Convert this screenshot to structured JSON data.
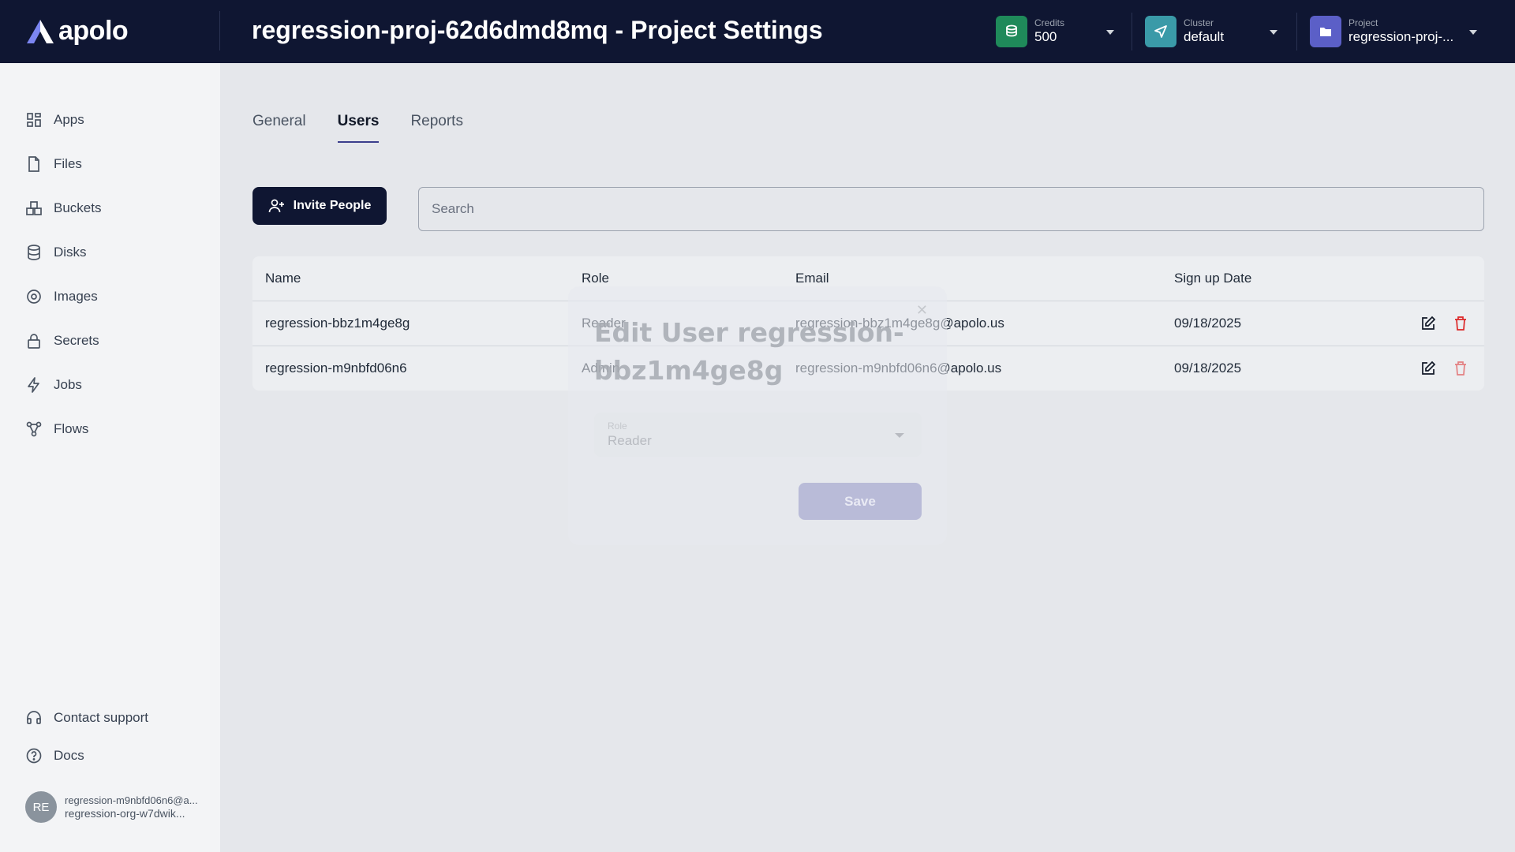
{
  "app": {
    "logo_text": "apolo"
  },
  "header": {
    "title": "regression-proj-62d6dmd8mq - Project Settings",
    "credits": {
      "label": "Credits",
      "value": "500",
      "icon": "coins-icon",
      "color": "#1f8a5a"
    },
    "cluster": {
      "label": "Cluster",
      "value": "default",
      "icon": "send-icon",
      "color": "#3a9aa8"
    },
    "project": {
      "label": "Project",
      "value": "regression-proj-...",
      "icon": "folder-icon",
      "color": "#5b5fc7"
    }
  },
  "sidebar": {
    "items": [
      {
        "label": "Apps",
        "icon": "grid-icon"
      },
      {
        "label": "Files",
        "icon": "file-icon"
      },
      {
        "label": "Buckets",
        "icon": "bucket-icon"
      },
      {
        "label": "Disks",
        "icon": "database-icon"
      },
      {
        "label": "Images",
        "icon": "disc-icon"
      },
      {
        "label": "Secrets",
        "icon": "lock-icon"
      },
      {
        "label": "Jobs",
        "icon": "bolt-icon"
      },
      {
        "label": "Flows",
        "icon": "flow-icon"
      }
    ],
    "support": {
      "label": "Contact support",
      "icon": "headset-icon"
    },
    "docs": {
      "label": "Docs",
      "icon": "help-circle-icon"
    },
    "user": {
      "initials": "RE",
      "email": "regression-m9nbfd06n6@a...",
      "org": "regression-org-w7dwik..."
    }
  },
  "tabs": [
    {
      "label": "General",
      "active": false
    },
    {
      "label": "Users",
      "active": true
    },
    {
      "label": "Reports",
      "active": false
    }
  ],
  "toolbar": {
    "invite_label": "Invite People",
    "search_placeholder": "Search"
  },
  "table": {
    "columns": [
      "Name",
      "Role",
      "Email",
      "Sign up Date"
    ],
    "rows": [
      {
        "name": "regression-bbz1m4ge8g",
        "role": "Reader",
        "email": "regression-bbz1m4ge8g@apolo.us",
        "date": "09/18/2025"
      },
      {
        "name": "regression-m9nbfd06n6",
        "role": "Admin",
        "email": "regression-m9nbfd06n6@apolo.us",
        "date": "09/18/2025"
      }
    ]
  },
  "modal": {
    "title": "Edit User regression-bbz1m4ge8g",
    "role_label": "Role",
    "role_value": "Reader",
    "save_label": "Save",
    "close_glyph": "✕"
  },
  "colors": {
    "brand_dark": "#0f1632",
    "accent": "#3b3f8c",
    "danger": "#dc2626"
  }
}
